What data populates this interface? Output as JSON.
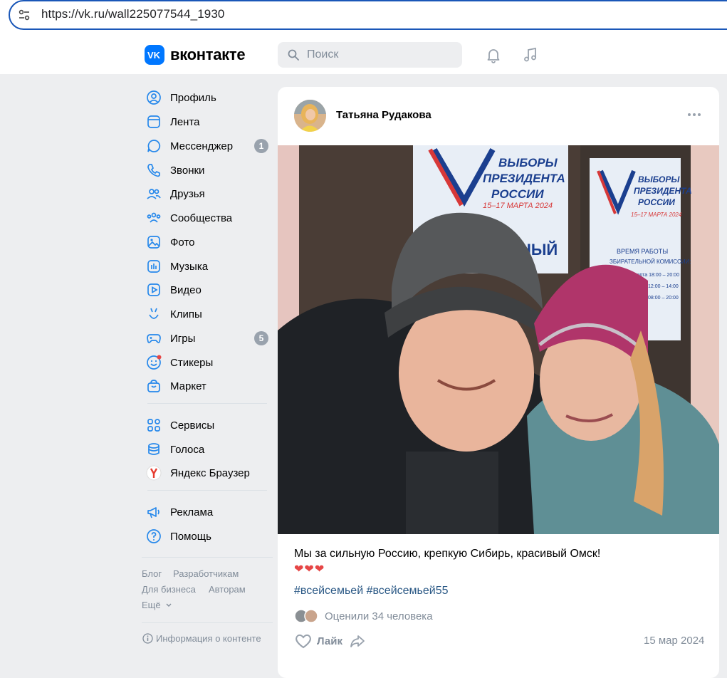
{
  "browser": {
    "url": "https://vk.ru/wall225077544_1930"
  },
  "header": {
    "logo_text": "вконтакте",
    "search_placeholder": "Поиск",
    "brand_color": "#0077ff"
  },
  "sidebar": {
    "items": [
      {
        "label": "Профиль",
        "icon": "profile-icon"
      },
      {
        "label": "Лента",
        "icon": "news-icon"
      },
      {
        "label": "Мессенджер",
        "icon": "message-icon",
        "badge": "1"
      },
      {
        "label": "Звонки",
        "icon": "phone-icon"
      },
      {
        "label": "Друзья",
        "icon": "friends-icon"
      },
      {
        "label": "Сообщества",
        "icon": "communities-icon"
      },
      {
        "label": "Фото",
        "icon": "photo-icon"
      },
      {
        "label": "Музыка",
        "icon": "music-icon"
      },
      {
        "label": "Видео",
        "icon": "video-icon"
      },
      {
        "label": "Клипы",
        "icon": "clips-icon"
      },
      {
        "label": "Игры",
        "icon": "games-icon",
        "badge": "5"
      },
      {
        "label": "Стикеры",
        "icon": "stickers-icon"
      },
      {
        "label": "Маркет",
        "icon": "market-icon"
      }
    ],
    "items2": [
      {
        "label": "Сервисы",
        "icon": "services-icon"
      },
      {
        "label": "Голоса",
        "icon": "votes-icon"
      },
      {
        "label": "Яндекс Браузер",
        "icon": "yandex-icon"
      }
    ],
    "items3": [
      {
        "label": "Реклама",
        "icon": "ads-icon"
      },
      {
        "label": "Помощь",
        "icon": "help-icon"
      }
    ],
    "footer": {
      "blog": "Блог",
      "developers": "Разработчикам",
      "business": "Для бизнеса",
      "authors": "Авторам",
      "more": "Ещё",
      "info": "Информация о контенте"
    }
  },
  "post": {
    "author": "Татьяна Рудакова",
    "text": "Мы за сильную Россию, крепкую Сибирь, красивый Омск!",
    "emojis": "❤❤❤",
    "hashtags": "#всейсемьей #всейсемьей55",
    "rated": "Оценили 34 человека",
    "like_label": "Лайк",
    "date": "15 мар 2024",
    "poster": {
      "line1": "ВЫБОРЫ",
      "line2": "ПРЕЗИДЕНТА",
      "line3": "РОССИИ",
      "dates": "15–17 МАРТА 2024",
      "fragment": "НЫЙ",
      "hours_title": "ВРЕМЯ РАБОТЫ",
      "hours_sub": "ЗБИРАТЕЛЬНОЙ КОМИССИИ:",
      "hours_row1": "14 марта  18:00 – 20:00",
      "hours_row2": "12:00 – 14:00",
      "hours_row3": "08:00 – 20:00"
    }
  }
}
